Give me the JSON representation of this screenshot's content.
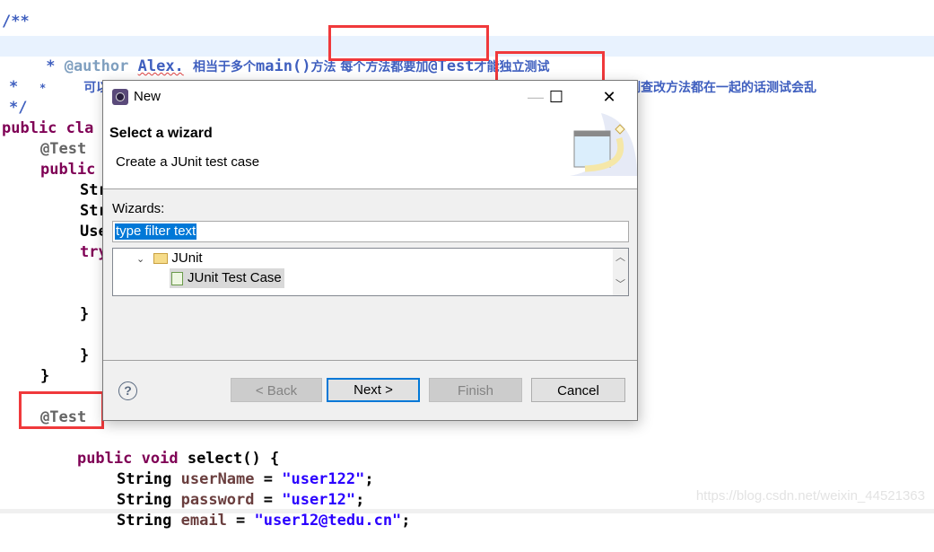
{
  "editor": {
    "comment": {
      "open": "/**",
      "author_tag": "@author",
      "author_name": "Alex.",
      "line1_cjk_a": "相当于多个",
      "line1_main": "main()",
      "line1_cjk_b": "方法",
      "line1_cjk_c": "每个方法都要加",
      "line1_test": "@Test",
      "line1_cjk_d": "才能独立测试",
      "line2": "可以独立的测试每个方法也可以一起测试，但是这个功能主要是解决了单个方法的测试 不然如果增删查改方法都在一起的话测试会乱",
      "star": "*",
      "close": "*/"
    },
    "code": {
      "class_decl": "public cla",
      "ann_test": "@Test",
      "public_kw": "public",
      "str1": "Str",
      "str2": "Str",
      "use": "Use",
      "try_kw": "try",
      "brace_close_catch": "}",
      "brace_close": "}",
      "brace_close_method": "}",
      "ann_test2": "@Test",
      "select_public": "public",
      "select_void": "void",
      "select_sig": "select() {",
      "type_string": "String",
      "var_username": "userName",
      "val_username": "\"user122\"",
      "var_password": "password",
      "val_password": "\"user12\"",
      "var_email": "email",
      "val_email": "\"user12@tedu.cn\"",
      "eq": " = ",
      "semi": ";"
    },
    "watermark": "https://blog.csdn.net/weixin_44521363"
  },
  "dialog": {
    "title": "New",
    "header_title": "Select a wizard",
    "header_desc": "Create a JUnit test case",
    "wizards_label": "Wizards:",
    "filter_value": "type filter text",
    "tree": [
      {
        "label": "JUnit",
        "expanded": true
      },
      {
        "label": "JUnit Test Case",
        "selected": true
      }
    ],
    "buttons": {
      "back": "< Back",
      "next": "Next >",
      "finish": "Finish",
      "cancel": "Cancel"
    },
    "help": "?",
    "window_controls": {
      "minimize": "—",
      "maximize": "☐",
      "close": "✕"
    }
  }
}
